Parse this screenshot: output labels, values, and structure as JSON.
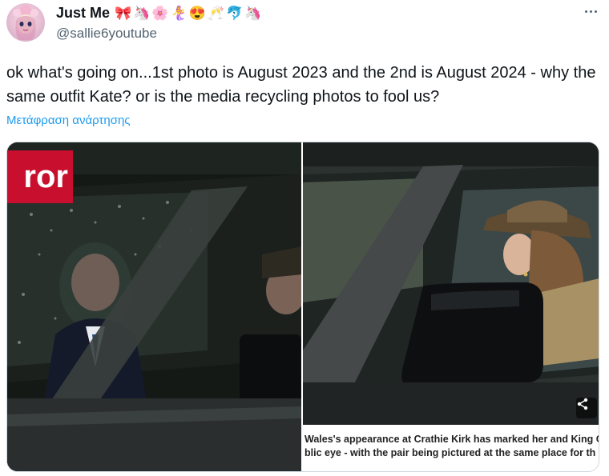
{
  "author": {
    "display_name": "Just Me",
    "emojis": [
      "🎀",
      "🦄",
      "🌸",
      "🧜‍♀️",
      "😍",
      "🥂",
      "🐬",
      "🦄"
    ],
    "handle": "@sallie6youtube"
  },
  "tweet": {
    "text": "ok what's going on...1st photo is August 2023 and the 2nd is August 2024 - why the same outfit Kate?  or is the media recycling photos to fool us?",
    "translate_label": "Μετάφραση ανάρτησης"
  },
  "media": {
    "photo1": {
      "brand_tag": "ror"
    },
    "photo2": {
      "caption_line1": "Wales's appearance at Crathie Kirk has marked her and King C",
      "caption_line2": "blic eye - with the pair being pictured at the same place for th"
    }
  },
  "colors": {
    "link": "#1d9bf0",
    "secondary_text": "#536471",
    "brand_red": "#c8102e"
  },
  "icons": {
    "more": "more-horizontal-icon",
    "share": "share-icon"
  }
}
